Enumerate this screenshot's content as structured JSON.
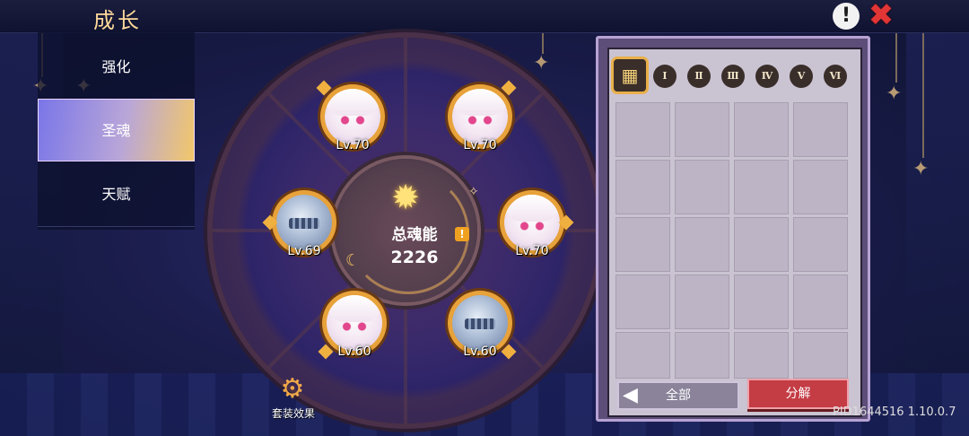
{
  "header": {
    "title": "成长"
  },
  "sidebar": {
    "items": [
      {
        "label": "强化",
        "active": false
      },
      {
        "label": "圣魂",
        "active": true
      },
      {
        "label": "天赋",
        "active": false
      }
    ]
  },
  "wheel": {
    "total_label": "总魂能",
    "total_value": "2226",
    "slots": [
      {
        "level": "Lv.70",
        "type": "character"
      },
      {
        "level": "Lv.70",
        "type": "character"
      },
      {
        "level": "Lv.69",
        "type": "armor"
      },
      {
        "level": "Lv.70",
        "type": "character"
      },
      {
        "level": "Lv.60",
        "type": "character"
      },
      {
        "level": "Lv.60",
        "type": "armor"
      }
    ]
  },
  "set_effect": {
    "label": "套装效果"
  },
  "inventory": {
    "filters": [
      "Ⅰ",
      "Ⅱ",
      "Ⅲ",
      "Ⅳ",
      "Ⅴ",
      "Ⅵ"
    ],
    "all_button": "全部",
    "decompose_button": "分解"
  },
  "footer": {
    "pid": "PID1644516 1.10.0.7"
  },
  "colors": {
    "accent": "#f0b040",
    "danger": "#c43c44",
    "panel": "#5c4e78"
  }
}
